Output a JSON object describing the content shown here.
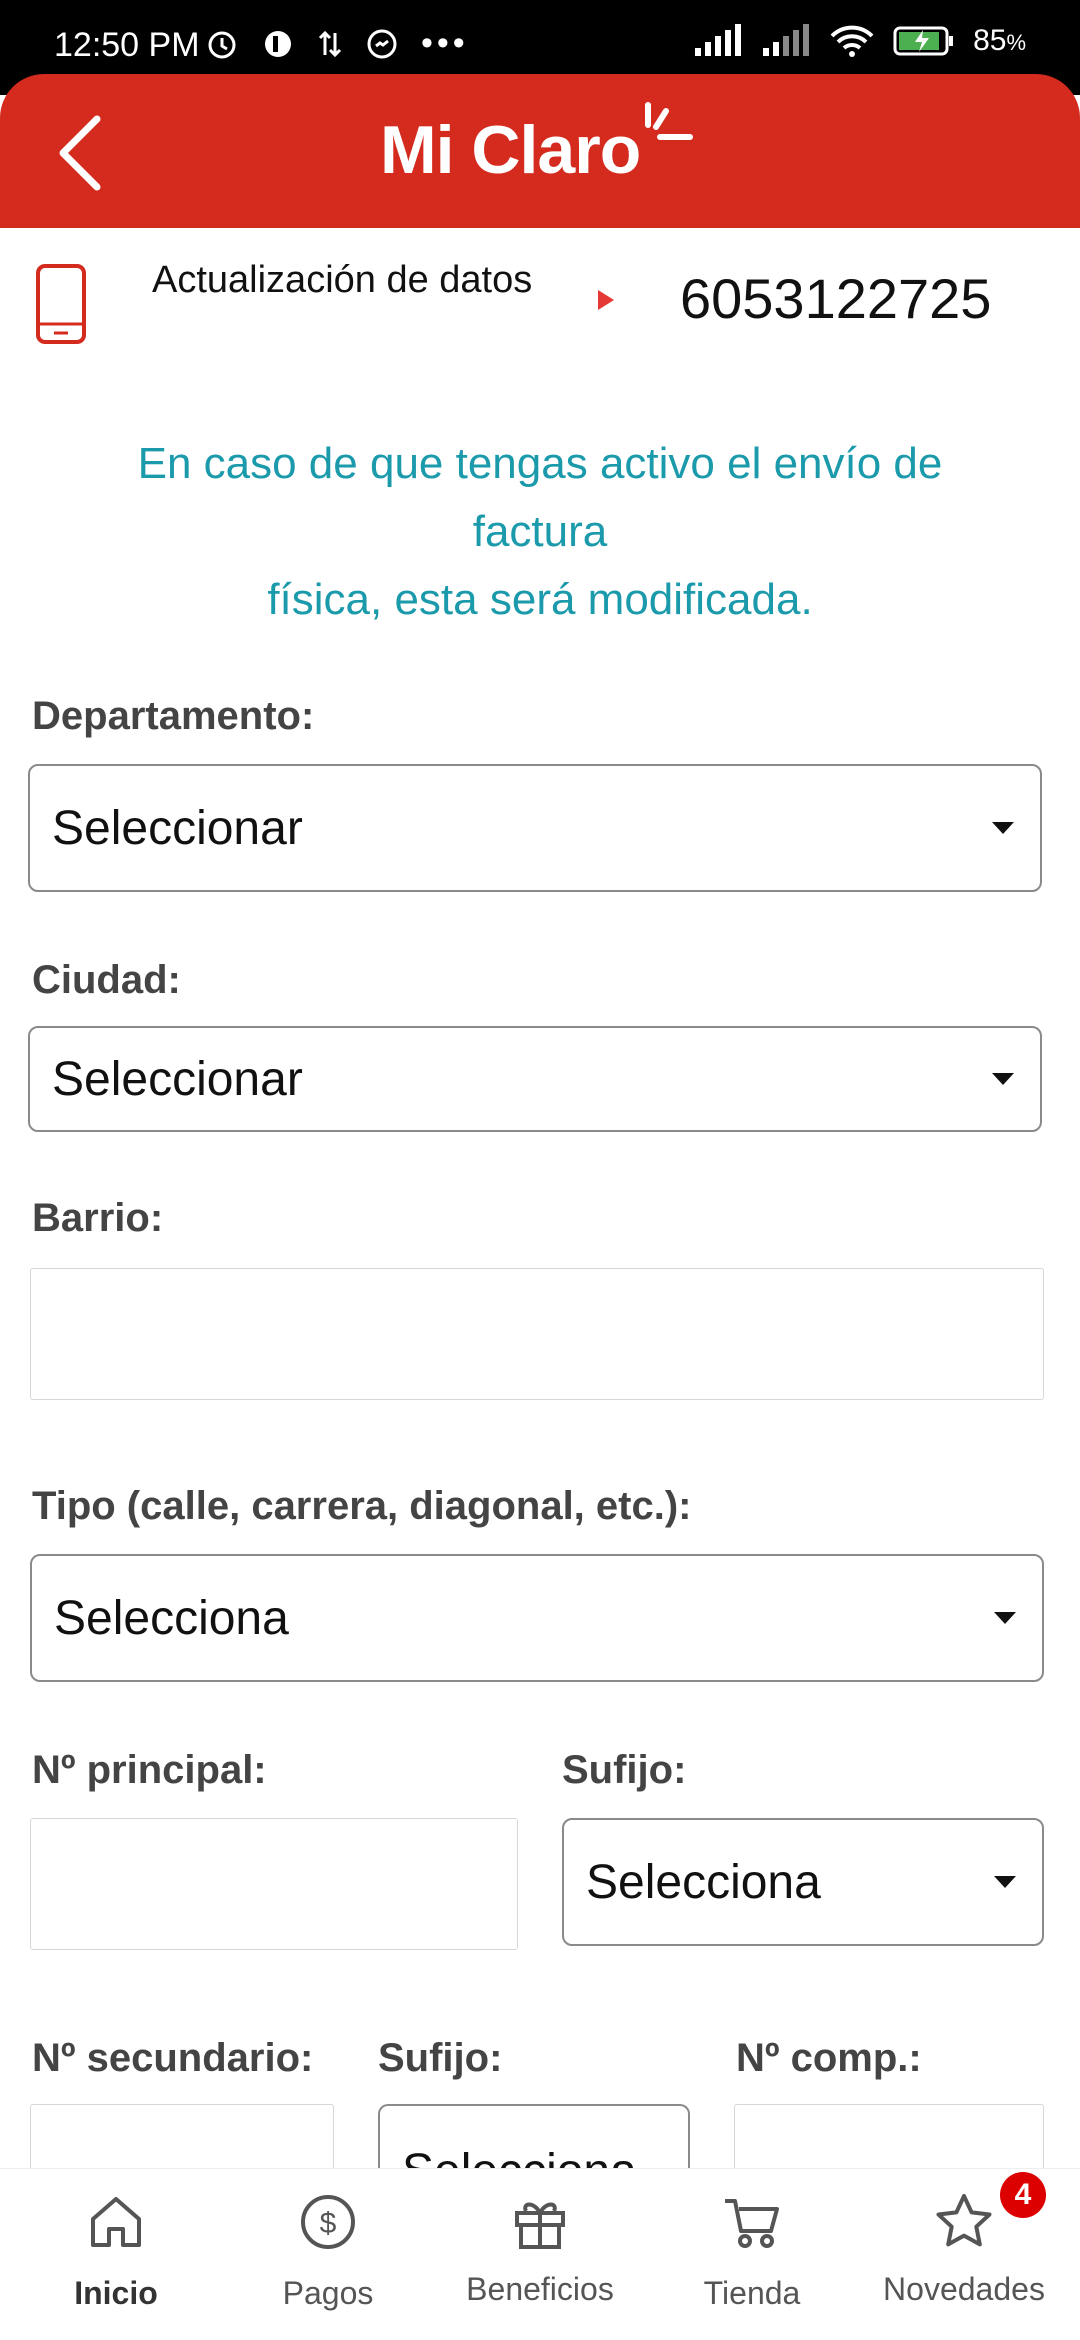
{
  "status_bar": {
    "time": "12:50 PM",
    "battery": "85",
    "battery_suffix": "%"
  },
  "app_bar": {
    "logo": "Mi Claro"
  },
  "line_info": {
    "label": "Actualización de datos",
    "number": "6053122725"
  },
  "notice": {
    "line1": "En caso de que tengas activo el envío de",
    "line2": "factura",
    "line3": "física, esta será modificada."
  },
  "form": {
    "departamento": {
      "label": "Departamento:",
      "value": "Seleccionar"
    },
    "ciudad": {
      "label": "Ciudad:",
      "value": "Seleccionar"
    },
    "barrio": {
      "label": "Barrio:",
      "value": ""
    },
    "tipo": {
      "label": "Tipo (calle, carrera, diagonal, etc.):",
      "value": "Selecciona"
    },
    "no_principal": {
      "label": "Nº principal:",
      "value": ""
    },
    "sufijo1": {
      "label": "Sufijo:",
      "value": "Selecciona"
    },
    "no_secundario": {
      "label": "Nº secundario:",
      "value": ""
    },
    "sufijo2": {
      "label": "Sufijo:",
      "value": "Selecciona"
    },
    "no_comp": {
      "label": "Nº comp.:",
      "value": ""
    }
  },
  "bottom_nav": {
    "items": [
      {
        "label": "Inicio",
        "icon": "home-icon"
      },
      {
        "label": "Pagos",
        "icon": "dollar-icon"
      },
      {
        "label": "Beneficios",
        "icon": "gift-icon"
      },
      {
        "label": "Tienda",
        "icon": "cart-icon"
      },
      {
        "label": "Novedades",
        "icon": "star-icon"
      }
    ],
    "badge": "4"
  },
  "colors": {
    "brand_red": "#d52b1e",
    "notice_teal": "#1a9aab"
  }
}
